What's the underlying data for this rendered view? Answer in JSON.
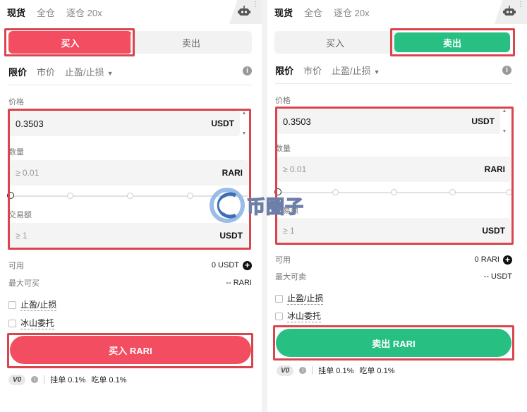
{
  "header": {
    "tabs": [
      "现货",
      "全仓",
      "逐仓 20x"
    ]
  },
  "side": {
    "buy": "买入",
    "sell": "卖出"
  },
  "order_types": [
    "限价",
    "市价",
    "止盈/止损"
  ],
  "fields": {
    "price_label": "价格",
    "price_value": "0.3503",
    "price_unit": "USDT",
    "amount_label": "数量",
    "amount_placeholder": "≥ 0.01",
    "amount_unit": "RARI",
    "total_label": "交易额",
    "total_placeholder": "≥ 1",
    "total_unit": "USDT"
  },
  "buy_panel": {
    "available_label": "可用",
    "available_value": "0 USDT",
    "max_label": "最大可买",
    "max_value": "-- RARI",
    "submit": "买入 RARI"
  },
  "sell_panel": {
    "available_label": "可用",
    "available_value": "0 RARI",
    "max_label": "最大可卖",
    "max_value": "-- USDT",
    "submit": "卖出 RARI"
  },
  "options": {
    "tpsl": "止盈/止损",
    "iceberg": "冰山委托"
  },
  "fees": {
    "vip": "V0",
    "maker": "挂单 0.1%",
    "taker": "吃单 0.1%"
  },
  "watermark": "币圈子",
  "colors": {
    "buy": "#f34d61",
    "sell": "#27bf82",
    "highlight": "#d9454d"
  }
}
